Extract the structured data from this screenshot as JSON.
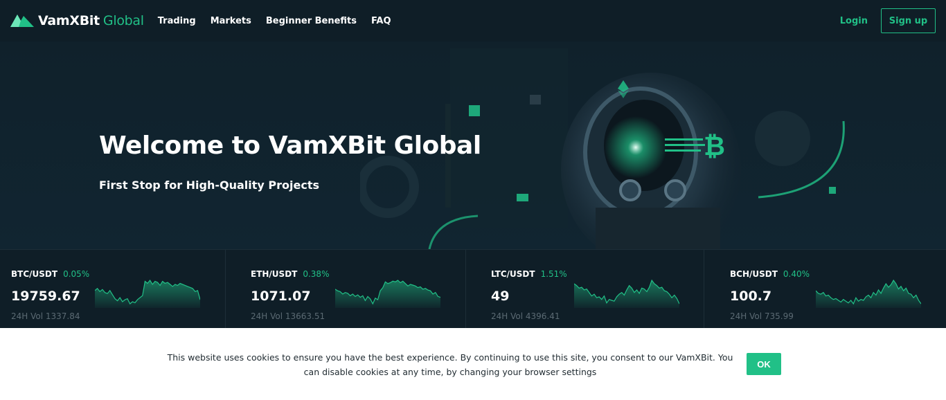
{
  "brand": {
    "name_white": "VamXBit",
    "name_green": "Global",
    "accent": "#21c087"
  },
  "nav": {
    "links": [
      "Trading",
      "Markets",
      "Beginner Benefits",
      "FAQ"
    ],
    "login": "Login",
    "signup": "Sign up"
  },
  "hero": {
    "title": "Welcome to VamXBit Global",
    "subtitle": "First Stop for High-Quality Projects",
    "art_icons": [
      "ethereum-icon",
      "bitcoin-icon",
      "astronaut-helmet-illustration"
    ]
  },
  "tickers": [
    {
      "pair": "BTC/USDT",
      "change": "0.05%",
      "price": "19759.67",
      "vol": "24H Vol 1337.84",
      "spark": [
        38,
        40,
        37,
        39,
        36,
        35,
        38,
        34,
        30,
        28,
        31,
        27,
        29,
        30,
        25,
        27,
        26,
        29,
        31,
        33,
        47,
        45,
        48,
        44,
        47,
        46,
        43,
        47,
        45,
        46,
        44,
        42,
        44,
        43,
        45,
        44,
        43,
        42,
        41,
        40,
        37,
        38,
        29
      ]
    },
    {
      "pair": "ETH/USDT",
      "change": "0.38%",
      "price": "1071.07",
      "vol": "24H Vol 13663.51",
      "spark": [
        36,
        34,
        33,
        30,
        32,
        31,
        28,
        30,
        27,
        29,
        26,
        28,
        22,
        27,
        24,
        18,
        25,
        23,
        34,
        38,
        45,
        43,
        44,
        46,
        45,
        47,
        44,
        46,
        43,
        40,
        42,
        41,
        40,
        38,
        39,
        36,
        37,
        35,
        34,
        30,
        32,
        27,
        26
      ]
    },
    {
      "pair": "LTC/USDT",
      "change": "1.51%",
      "price": "49",
      "vol": "24H Vol 4396.41",
      "spark": [
        40,
        38,
        35,
        36,
        33,
        34,
        30,
        26,
        28,
        24,
        25,
        22,
        26,
        18,
        22,
        21,
        20,
        25,
        28,
        30,
        27,
        33,
        38,
        35,
        30,
        33,
        29,
        35,
        34,
        31,
        36,
        44,
        40,
        38,
        35,
        36,
        32,
        31,
        28,
        24,
        27,
        23,
        17
      ]
    },
    {
      "pair": "BCH/USDT",
      "change": "0.40%",
      "price": "100.7",
      "vol": "24H Vol 735.99",
      "spark": [
        30,
        27,
        26,
        28,
        24,
        25,
        22,
        20,
        21,
        19,
        17,
        20,
        18,
        16,
        19,
        15,
        22,
        18,
        20,
        19,
        23,
        25,
        22,
        28,
        25,
        31,
        27,
        33,
        38,
        34,
        37,
        42,
        38,
        32,
        35,
        30,
        33,
        27,
        26,
        22,
        25,
        19,
        15
      ]
    }
  ],
  "cookie": {
    "text": "This website uses cookies to ensure you have the best experience. By continuing to use this site, you consent to our VamXBit. You can disable cookies at any time, by changing your browser settings",
    "ok": "OK"
  }
}
